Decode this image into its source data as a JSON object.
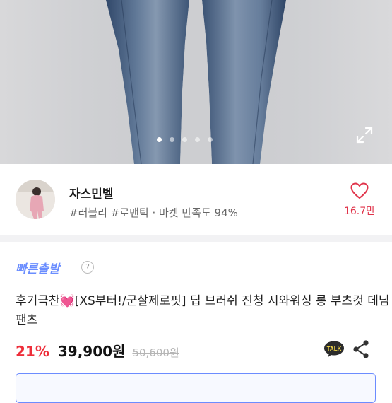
{
  "gallery": {
    "page_count": 5,
    "active_index": 0,
    "expand_icon": "expand-icon"
  },
  "seller": {
    "name": "자스민벨",
    "tags": "#러블리 #로맨틱 · 마켓 만족도 94%",
    "favorite_count": "16.7만",
    "favorite_icon": "heart-outline-icon"
  },
  "product": {
    "badge": "빠른출발",
    "help_symbol": "?",
    "title_prefix": "후기극찬",
    "title_emoji": "💓",
    "title_rest": "[XS부터!/군살제로핏] 딥 브러쉬 진청 시와워싱 롱 부츠컷 데님 팬츠",
    "discount": "21%",
    "price": "39,900원",
    "original_price": "50,600원",
    "talk_label": "TALK"
  },
  "colors": {
    "accent_red": "#ee2e3a",
    "badge_blue": "#6a8dff",
    "heart_red": "#e0334a"
  }
}
